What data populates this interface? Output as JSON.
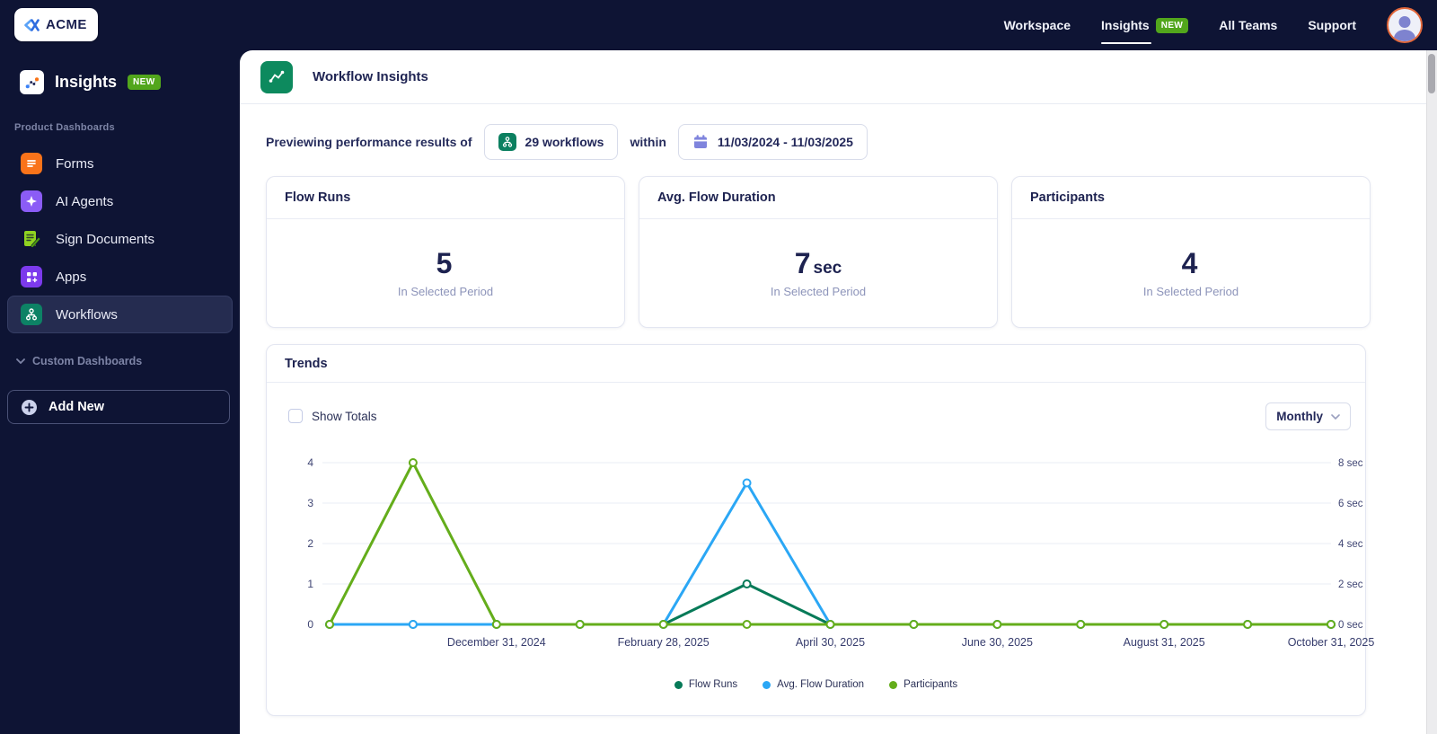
{
  "brand": {
    "logo_text": "ACME"
  },
  "topnav": {
    "workspace": "Workspace",
    "insights": "Insights",
    "insights_badge": "NEW",
    "all_teams": "All Teams",
    "support": "Support"
  },
  "sidebar": {
    "header": {
      "title": "Insights",
      "badge": "NEW"
    },
    "section_label": "Product Dashboards",
    "items": [
      {
        "label": "Forms"
      },
      {
        "label": "AI Agents"
      },
      {
        "label": "Sign Documents"
      },
      {
        "label": "Apps"
      },
      {
        "label": "Workflows",
        "active": true
      }
    ],
    "custom_section_label": "Custom Dashboards",
    "add_new_label": "Add New"
  },
  "header": {
    "title": "Workflow Insights"
  },
  "filter_bar": {
    "lead_text": "Previewing performance results of",
    "workflows_chip": "29 workflows",
    "connector": "within",
    "date_range": "11/03/2024 - 11/03/2025"
  },
  "stat_cards": [
    {
      "title": "Flow Runs",
      "value": "5",
      "unit": "",
      "caption": "In Selected Period"
    },
    {
      "title": "Avg. Flow Duration",
      "value": "7",
      "unit": "sec",
      "caption": "In Selected Period"
    },
    {
      "title": "Participants",
      "value": "4",
      "unit": "",
      "caption": "In Selected Period"
    }
  ],
  "trends": {
    "title": "Trends",
    "show_totals_label": "Show Totals",
    "show_totals_checked": false,
    "interval_selected": "Monthly"
  },
  "chart_data": {
    "type": "line",
    "x_point_count": 13,
    "x_tick_labels": [
      {
        "index": 2,
        "label": "December 31, 2024"
      },
      {
        "index": 4,
        "label": "February 28, 2025"
      },
      {
        "index": 6,
        "label": "April 30, 2025"
      },
      {
        "index": 8,
        "label": "June 30, 2025"
      },
      {
        "index": 10,
        "label": "August 31, 2025"
      },
      {
        "index": 12,
        "label": "October 31, 2025"
      }
    ],
    "left_axis": {
      "tick_labels": [
        "0",
        "1",
        "2",
        "3",
        "4"
      ],
      "range": [
        0,
        4
      ]
    },
    "right_axis": {
      "tick_labels": [
        "0 sec",
        "2 sec",
        "4 sec",
        "6 sec",
        "8 sec"
      ],
      "range": [
        0,
        8
      ]
    },
    "grid": true,
    "legend_position": "bottom",
    "series": [
      {
        "name": "Flow Runs",
        "axis": "left",
        "color": "#077a58",
        "values": [
          0,
          0,
          0,
          0,
          0,
          1,
          0,
          0,
          0,
          0,
          0,
          0,
          0
        ]
      },
      {
        "name": "Avg. Flow Duration",
        "axis": "right",
        "color": "#2ba7f5",
        "values": [
          0,
          0,
          0,
          0,
          0,
          7,
          0,
          0,
          0,
          0,
          0,
          0,
          0
        ]
      },
      {
        "name": "Participants",
        "axis": "left",
        "color": "#64ad1b",
        "values": [
          0,
          4,
          0,
          0,
          0,
          0,
          0,
          0,
          0,
          0,
          0,
          0,
          0
        ]
      }
    ]
  },
  "colors": {
    "navy_bg": "#0e1434",
    "badge_green": "#52a61c",
    "workflow_green": "#0d8a5e",
    "flow_runs": "#077a58",
    "avg_flow_duration": "#2ba7f5",
    "participants": "#64ad1b"
  },
  "icons": {
    "acme-logo-icon": "blue double-chevron x mark",
    "insights-icon": "scatter dots with connector",
    "forms-icon": "orange tile with lines",
    "ai-agents-icon": "purple tile with sparkle",
    "sign-documents-icon": "lime document with pen",
    "apps-icon": "purple tile with grid",
    "workflows-icon": "teal tile with org-chart",
    "calendar-icon": "purple calendar",
    "plus-circle-icon": "plus in circle",
    "chevron-down-icon": "chevron down",
    "user-avatar-icon": "person silhouette"
  }
}
